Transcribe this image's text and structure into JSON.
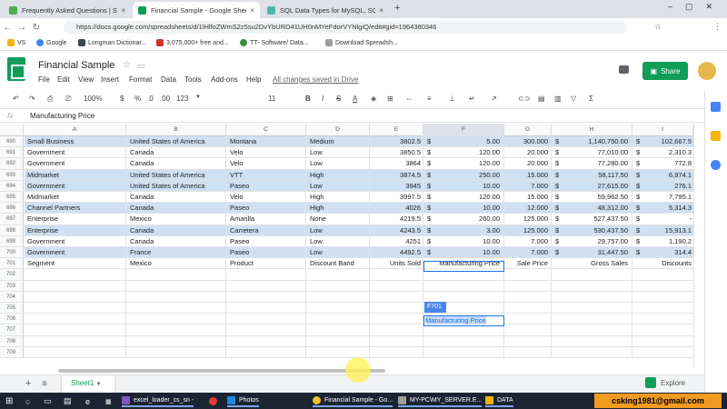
{
  "browser": {
    "tabs": [
      {
        "label": "Frequently Asked Questions | Sp",
        "icon_color": "#4caf50",
        "active": false
      },
      {
        "label": "Financial Sample - Google Sheets",
        "icon_color": "#0f9d58",
        "active": true
      },
      {
        "label": "SQL Data Types for MySQL, SQL S",
        "icon_color": "#4db6ac",
        "active": false
      }
    ],
    "new_tab": "+",
    "url": "https://docs.google.com/spreadsheets/d/1lHlfoZWmS2z5su2DvYbURD41UH0nMYeFdorVYNlgiQ/edit#gid=1964380346",
    "bookmarks": [
      "VS",
      "Google",
      "Longman Dictionar...",
      "3,075,000+ free and...",
      "TT- Software/ Data...",
      "Download Spreadsh..."
    ]
  },
  "doc": {
    "title": "Financial Sample",
    "menu": [
      "File",
      "Edit",
      "View",
      "Insert",
      "Format",
      "Data",
      "Tools",
      "Add-ons",
      "Help"
    ],
    "saved_status": "All changes saved in Drive",
    "share_label": "Share"
  },
  "toolbar": {
    "zoom": "100%",
    "currency": "$",
    "percent": "%",
    "dec_minus": ".0",
    "dec_plus": ".00",
    "format": "123",
    "font_size": "11",
    "bold": "B",
    "italic": "I",
    "strike": "S",
    "textcolor": "A"
  },
  "formula_bar": {
    "fx": "fx",
    "value": "Manufacturing Price"
  },
  "grid": {
    "columns": [
      "A",
      "B",
      "C",
      "D",
      "E",
      "F",
      "G",
      "H",
      "I"
    ],
    "selected_column": "F",
    "rows": [
      {
        "n": "690",
        "cells": [
          "Small Business",
          "United States of America",
          "Montana",
          "Medium",
          "3802.5",
          "$",
          "5.00",
          "300.000",
          "$",
          "1,140,750.00",
          "$",
          "102,667.5"
        ],
        "band": true
      },
      {
        "n": "691",
        "cells": [
          "Government",
          "Canada",
          "Velo",
          "Low",
          "3850.5",
          "$",
          "120.00",
          "20.000",
          "$",
          "77,010.00",
          "$",
          "2,310.3"
        ],
        "band": false
      },
      {
        "n": "692",
        "cells": [
          "Government",
          "Canada",
          "Velo",
          "Low",
          "3864",
          "$",
          "120.00",
          "20.000",
          "$",
          "77,280.00",
          "$",
          "772.8"
        ],
        "band": false
      },
      {
        "n": "693",
        "cells": [
          "Midmarket",
          "United States of America",
          "VTT",
          "High",
          "3874.5",
          "$",
          "250.00",
          "15.000",
          "$",
          "58,117.50",
          "$",
          "6,974.1"
        ],
        "band": true
      },
      {
        "n": "694",
        "cells": [
          "Government",
          "United States of America",
          "Paseo",
          "Low",
          "3945",
          "$",
          "10.00",
          "7.000",
          "$",
          "27,615.00",
          "$",
          "276.1"
        ],
        "band": true
      },
      {
        "n": "695",
        "cells": [
          "Midmarket",
          "Canada",
          "Velo",
          "High",
          "3997.5",
          "$",
          "120.00",
          "15.000",
          "$",
          "59,962.50",
          "$",
          "7,795.1"
        ],
        "band": false
      },
      {
        "n": "696",
        "cells": [
          "Channel Partners",
          "Canada",
          "Paseo",
          "High",
          "4026",
          "$",
          "10.00",
          "12.000",
          "$",
          "48,312.00",
          "$",
          "5,314.3"
        ],
        "band": true
      },
      {
        "n": "697",
        "cells": [
          "Enterprise",
          "Mexico",
          "Amarilla",
          "None",
          "4219.5",
          "$",
          "260.00",
          "125.000",
          "$",
          "527,437.50",
          "$",
          "-"
        ],
        "band": false
      },
      {
        "n": "698",
        "cells": [
          "Enterprise",
          "Canada",
          "Carretera",
          "Low",
          "4243.5",
          "$",
          "3.00",
          "125.000",
          "$",
          "530,437.50",
          "$",
          "15,913.1"
        ],
        "band": true
      },
      {
        "n": "699",
        "cells": [
          "Government",
          "Canada",
          "Paseo",
          "Low",
          "4251",
          "$",
          "10.00",
          "7.000",
          "$",
          "29,757.00",
          "$",
          "1,190.2"
        ],
        "band": false
      },
      {
        "n": "700",
        "cells": [
          "Government",
          "France",
          "Paseo",
          "Low",
          "4492.5",
          "$",
          "10.00",
          "7.000",
          "$",
          "31,447.50",
          "$",
          "314.4"
        ],
        "band": true
      },
      {
        "n": "701",
        "cells": [
          "Segment",
          "Mexico",
          "Product",
          "Discount Band",
          "Units Sold",
          "",
          "Manufacturing Price",
          "Sale Price",
          "",
          "Gross Sales",
          "",
          "Discounts"
        ],
        "band": false
      },
      {
        "n": "702",
        "cells": [
          "",
          "",
          "",
          "",
          "",
          "",
          "",
          "",
          "",
          "",
          "",
          ""
        ],
        "band": false
      },
      {
        "n": "703",
        "cells": [
          "",
          "",
          "",
          "",
          "",
          "",
          "",
          "",
          "",
          "",
          "",
          ""
        ],
        "band": false
      },
      {
        "n": "704",
        "cells": [
          "",
          "",
          "",
          "",
          "",
          "",
          "",
          "",
          "",
          "",
          "",
          ""
        ],
        "band": false
      },
      {
        "n": "705",
        "cells": [
          "",
          "",
          "",
          "",
          "",
          "",
          "",
          "",
          "",
          "",
          "",
          ""
        ],
        "band": false
      },
      {
        "n": "706",
        "cells": [
          "",
          "",
          "",
          "",
          "",
          "",
          "",
          "",
          "",
          "",
          "",
          ""
        ],
        "band": false
      },
      {
        "n": "707",
        "cells": [
          "",
          "",
          "",
          "",
          "",
          "",
          "",
          "",
          "",
          "",
          "",
          ""
        ],
        "band": false
      },
      {
        "n": "708",
        "cells": [
          "",
          "",
          "",
          "",
          "",
          "",
          "",
          "",
          "",
          "",
          "",
          ""
        ],
        "band": false
      },
      {
        "n": "709",
        "cells": [
          "",
          "",
          "",
          "",
          "",
          "",
          "",
          "",
          "",
          "",
          "",
          ""
        ],
        "band": false
      }
    ],
    "cell_ref_tooltip": "F701",
    "edit_text": "Manufacturing Price"
  },
  "sheets": {
    "add": "+",
    "list": "≡",
    "active": "Sheet1",
    "explore": "Explore"
  },
  "taskbar": {
    "items": [
      "excel_loader_cs_sn -",
      "Photos",
      "Financial Sample - Go...",
      "MY-PC\\MY_SERVER.E...",
      "DATA"
    ],
    "user_label": "csking1981@gmail.com"
  },
  "colors": {
    "brand": "#0f9d58",
    "band": "#cfe0f3",
    "selection": "#1a73e8",
    "taskbar": "#1b2433",
    "email_bg": "#f29b21"
  }
}
